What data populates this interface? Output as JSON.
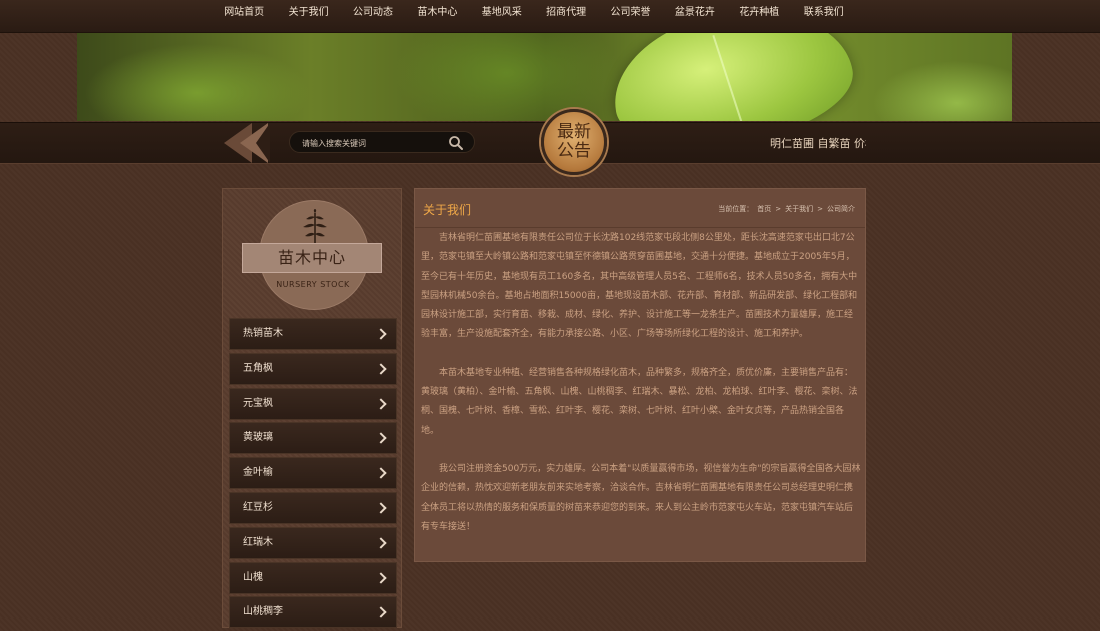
{
  "nav": {
    "items": [
      "网站首页",
      "关于我们",
      "公司动态",
      "苗木中心",
      "基地风采",
      "招商代理",
      "公司荣誉",
      "盆景花卉",
      "花卉种植",
      "联系我们"
    ]
  },
  "search": {
    "placeholder": "请输入搜索关键词",
    "icon": "search-icon"
  },
  "notice": {
    "badge_line1": "最新",
    "badge_line2": "公告",
    "text": "明仁苗圃 自繁苗 价格I"
  },
  "sidebar": {
    "title": "苗木中心",
    "subtitle": "NURSERY STOCK",
    "emblem_icon": "plant-icon",
    "items": [
      "热销苗木",
      "五角枫",
      "元宝枫",
      "黄玻璃",
      "金叶榆",
      "红豆杉",
      "红瑞木",
      "山槐",
      "山桃稠李"
    ]
  },
  "content": {
    "title": "关于我们",
    "breadcrumb": {
      "label": "当前位置：",
      "home": "首页",
      "sep": ">",
      "section": "关于我们",
      "page": "公司简介"
    },
    "paragraphs": [
      "吉林省明仁苗圃基地有限责任公司位于长沈路102线范家屯段北侧8公里处，距长沈高速范家屯出口北7公里，范家屯镇至大岭镇公路和范家屯镇至怀德镇公路贯穿苗圃基地，交通十分便捷。基地成立于2005年5月，至今已有十年历史，基地现有员工160多名，其中高级管理人员5名、工程师6名，技术人员50多名，拥有大中型园林机械50余台。基地占地面积15000亩，基地现设苗木部、花卉部、育材部、新品研发部、绿化工程部和园林设计施工部，实行育苗、移栽、成材、绿化、养护、设计施工等一龙条生产。苗圃技术力量雄厚，施工经验丰富，生产设施配套齐全，有能力承接公路、小区、广场等场所绿化工程的设计、施工和养护。",
      "本苗木基地专业种植、经营销售各种规格绿化苗木，品种繁多，规格齐全，质优价廉，主要销售产品有：黄玻璃（黄柏）、金叶榆、五角枫、山槐、山桃稠李、红瑞木、暴松、龙柏、龙柏球、红叶李、樱花、栾树、法桐、国槐、七叶树、香樟、雪松、红叶李、樱花、栾树、七叶树、红叶小檗、金叶女贞等，产品热销全国各地。",
      "我公司注册资金500万元，实力雄厚。公司本着\"以质量赢得市场，视信誉为生命\"的宗旨赢得全国各大园林企业的信赖，热忱欢迎新老朋友前来实地考察，洽谈合作。吉林省明仁苗圃基地有限责任公司总经理史明仁携全体员工将以热情的服务和保质量的树苗来恭迎您的到来。来人到公主岭市范家屯火车站，范家屯镇汽车站后有专车接送！"
    ]
  },
  "colors": {
    "background": "#4a3124",
    "accent_title": "#f0a848",
    "body_text": "#cba183"
  }
}
